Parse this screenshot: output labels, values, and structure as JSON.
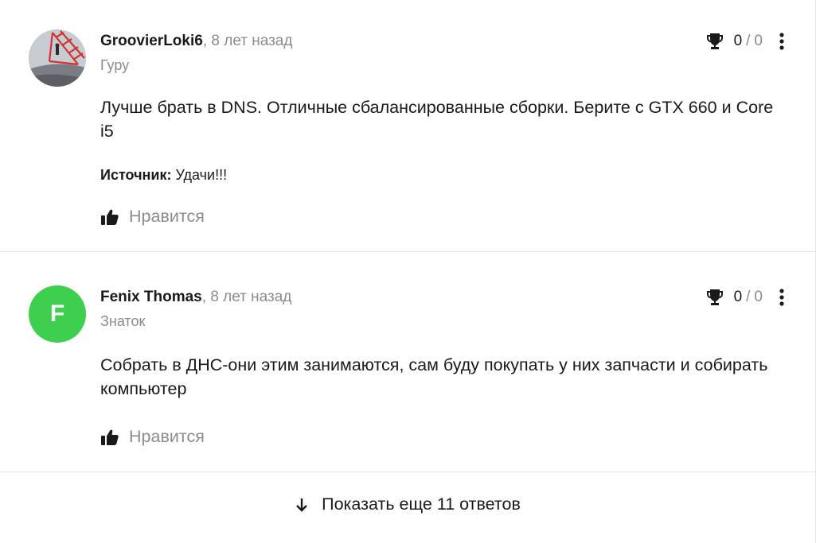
{
  "answers": [
    {
      "author": "GroovierLoki6",
      "separator": ",",
      "time": "8 лет назад",
      "rank": "Гуру",
      "score_up": "0",
      "score_slash": "/",
      "score_down": "0",
      "text": "Лучше брать в DNS. Отличные сбалансированные сборки. Берите с GTX 660 и Core i5",
      "source_label": "Источник:",
      "source_value": "Удачи!!!",
      "like_label": "Нравится",
      "avatar_icon": "user-photo-avatar"
    },
    {
      "author": "Fenix Thomas",
      "separator": ",",
      "time": "8 лет назад",
      "rank": "Знаток",
      "score_up": "0",
      "score_slash": "/",
      "score_down": "0",
      "text": "Собрать в ДНС-они этим занимаются, сам буду покупать у них запчасти и собирать компьютер",
      "like_label": "Нравится",
      "avatar_letter": "F",
      "avatar_color": "#3fcf4e"
    }
  ],
  "more": {
    "label": "Показать еще 11 ответов",
    "icon": "arrow-down-icon"
  },
  "icons": {
    "score": "trophy-icon",
    "menu": "more-vertical-icon",
    "like": "thumbs-up-icon"
  }
}
